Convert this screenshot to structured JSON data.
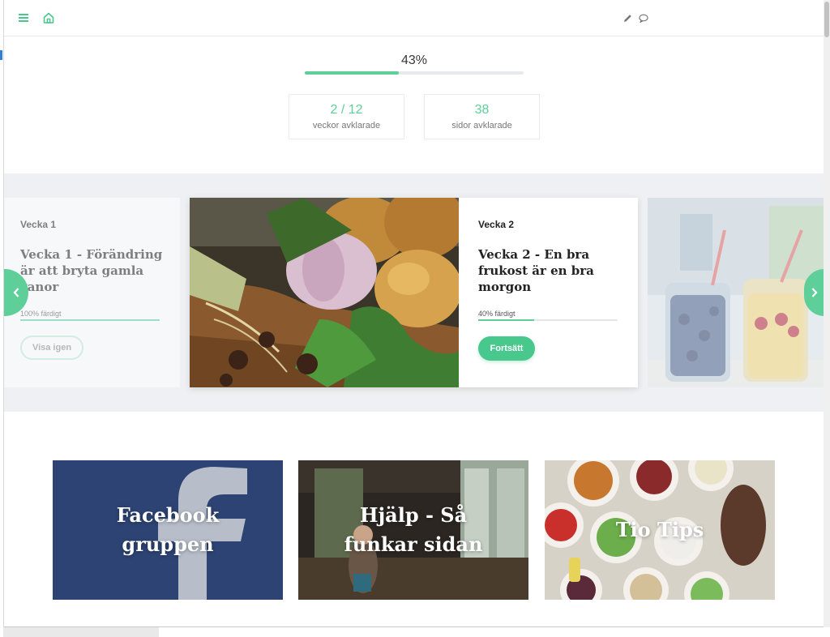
{
  "header": {
    "menu_icon": "hamburger-menu-icon",
    "home_icon": "home-icon",
    "edit_icon": "pencil-icon",
    "comment_icon": "speech-bubble-icon"
  },
  "progress": {
    "percent_label": "43%",
    "percent_value": 43,
    "stats": [
      {
        "value": "2 / 12",
        "label": "veckor avklarade"
      },
      {
        "value": "38",
        "label": "sidor avklarade"
      }
    ]
  },
  "carousel": {
    "prev_icon": "chevron-left-icon",
    "next_icon": "chevron-right-icon",
    "cards": [
      {
        "week": "Vecka 1",
        "title": "Vecka 1 - Förändring är att bryta gamla vanor",
        "progress_label": "100% färdigt",
        "progress": 100,
        "button": "Visa igen"
      },
      {
        "week": "Vecka 2",
        "title": "Vecka 2 - En bra frukost är en bra morgon",
        "progress_label": "40% färdigt",
        "progress": 40,
        "button": "Fortsätt"
      }
    ]
  },
  "tiles": [
    {
      "label": "Facebook gruppen"
    },
    {
      "label": "Hjälp - Så funkar sidan"
    },
    {
      "label": "Tio Tips"
    }
  ],
  "colors": {
    "accent": "#5ecf98",
    "button": "#49c88d",
    "facebook": "#2d4373"
  }
}
